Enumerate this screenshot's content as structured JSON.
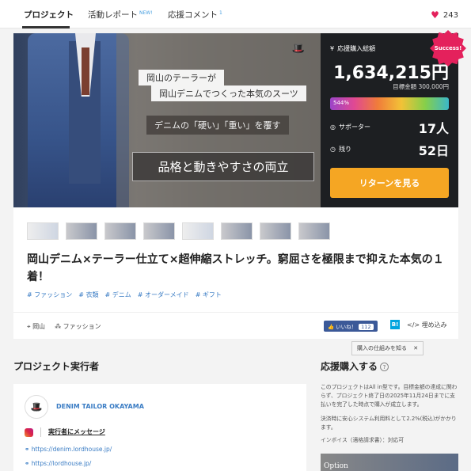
{
  "tabs": {
    "project": "プロジェクト",
    "report": "活動レポート",
    "report_badge": "NEW!",
    "comments": "応援コメント",
    "comments_count": "1"
  },
  "likes": {
    "count": "243"
  },
  "hero": {
    "line1": "岡山のテーラーが",
    "line2": "岡山デニムでつくった本気のスーツ",
    "line3": "デニムの「硬い」「重い」を覆す",
    "line4": "品格と動きやすさの両立"
  },
  "stats": {
    "total_label": "応援購入総額",
    "amount": "1,634,215円",
    "target": "目標金額 300,000円",
    "progress_text": "544%",
    "progress_value": 544,
    "supporters_label": "サポーター",
    "supporters_value": "17人",
    "remaining_label": "残り",
    "remaining_value": "52日",
    "return_button": "リターンを見る",
    "success_badge": "Success!"
  },
  "project": {
    "title": "岡山デニム×テーラー仕立て×超伸縮ストレッチ。窮屈さを極限まで抑えた本気の１着！",
    "tags": [
      "# ファッション",
      "# 衣類",
      "# デニム",
      "# オーダーメイド",
      "# ギフト"
    ],
    "location": "岡山",
    "category": "ファッション",
    "like_label": "いいね！",
    "like_count": "112",
    "hatena": "B!",
    "embed": "埋め込み"
  },
  "tooltip": {
    "text": "購入の仕組みを知る"
  },
  "owner": {
    "heading": "プロジェクト実行者",
    "name": "DENIM TAILOR OKAYAMA",
    "message": "実行者にメッセージ",
    "url1": "https://denim.lordhouse.jp/",
    "url2": "https://lordhouse.jp/"
  },
  "buy": {
    "heading": "応援購入する",
    "text1": "このプロジェクトはAll in型です。目標金額の達成に関わらず、プロジェクト終了日の2025年11月24日までに支払いを完了した時点で購入が成立します。",
    "text2": "決済時に安心システム利用料として2.2%(税込)がかかります。",
    "text3": "インボイス（適格請求書）：対応可",
    "option": "Option"
  }
}
